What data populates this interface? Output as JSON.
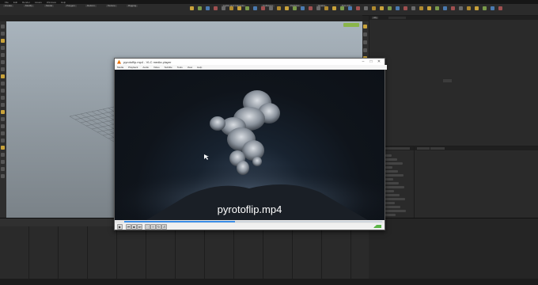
{
  "houdini": {
    "menu_items": [
      "File",
      "Edit",
      "Render",
      "Assets",
      "Windows",
      "Help"
    ],
    "shelf_tabs": [
      "Create",
      "Modify",
      "Model",
      "Polygon",
      "Deform",
      "Texture",
      "Rigging"
    ],
    "right_shelf_tabs": [
      "Lights and Cameras",
      "Collisions",
      "Particles",
      "Grains",
      "Pyro FX"
    ],
    "scene_view_tab": "Scene View",
    "network_tab": "obj",
    "param_tab": "Parameters"
  },
  "vlc": {
    "window_title": "pyrotoflip.mp4 - VLC media player",
    "menu": [
      "Media",
      "Playback",
      "Audio",
      "Video",
      "Subtitle",
      "Tools",
      "View",
      "Help"
    ],
    "caption": "pyrotoflip.mp4",
    "minimize": "–",
    "maximize": "□",
    "close": "✕",
    "progress": 0.43,
    "controls": [
      "play-icon",
      "prev-icon",
      "stop-icon",
      "next-icon",
      "fullscreen-icon",
      "playlist-icon",
      "loop-icon",
      "random-icon"
    ],
    "volume": 1.0
  },
  "colors": {
    "accent_green": "#8ab54a",
    "vlc_blue": "#3b8ee8"
  }
}
